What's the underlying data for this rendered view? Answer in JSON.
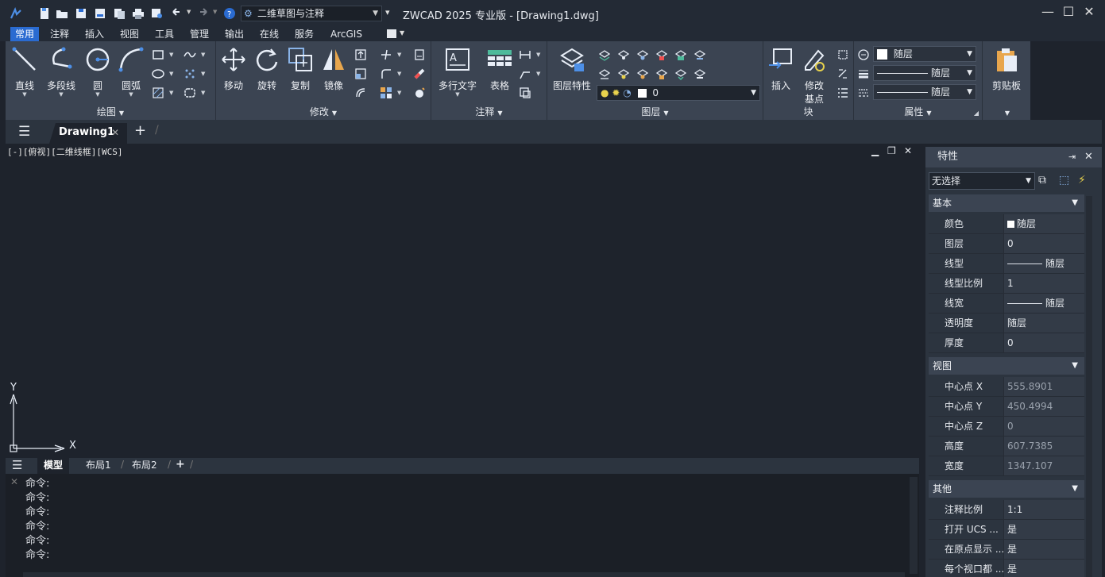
{
  "title_bar": {
    "workspace": "二维草图与注释",
    "app_title": "ZWCAD 2025 专业版 - [Drawing1.dwg]",
    "window_controls": [
      "minimize-icon",
      "maximize-icon",
      "close-icon"
    ]
  },
  "menu_tabs": [
    "常用",
    "注释",
    "插入",
    "视图",
    "工具",
    "管理",
    "输出",
    "在线",
    "服务",
    "ArcGIS"
  ],
  "ribbon": {
    "draw": {
      "label": "绘图",
      "buttons": [
        "直线",
        "多段线",
        "圆",
        "圆弧"
      ]
    },
    "modify": {
      "label": "修改",
      "buttons": [
        "移动",
        "旋转",
        "复制",
        "镜像"
      ]
    },
    "annotation": {
      "label": "注释",
      "buttons": [
        "多行文字",
        "表格"
      ]
    },
    "layer": {
      "label": "图层",
      "button": "图层特性",
      "current_layer": "0"
    },
    "block": {
      "label": "块",
      "buttons": [
        "插入",
        "修改",
        "基点"
      ]
    },
    "properties": {
      "label": "属性",
      "color": "随层",
      "linetype": "随层",
      "lineweight": "随层"
    },
    "clipboard": {
      "label": "剪贴板"
    }
  },
  "doc_tabs": {
    "active": "Drawing1"
  },
  "canvas": {
    "view_label": "[-][俯视][二维线框][WCS]",
    "axis_x": "X",
    "axis_y": "Y"
  },
  "layout_tabs": [
    "模型",
    "布局1",
    "布局2"
  ],
  "command_lines": [
    "命令:",
    "命令:",
    "命令:",
    "命令:",
    "命令:",
    "命令:"
  ],
  "properties_panel": {
    "title": "特性",
    "selection": "无选择",
    "sections": {
      "basic": {
        "label": "基本",
        "rows": [
          {
            "k": "颜色",
            "v": "随层"
          },
          {
            "k": "图层",
            "v": "0"
          },
          {
            "k": "线型",
            "v": "随层"
          },
          {
            "k": "线型比例",
            "v": "1"
          },
          {
            "k": "线宽",
            "v": "随层"
          },
          {
            "k": "透明度",
            "v": "随层"
          },
          {
            "k": "厚度",
            "v": "0"
          }
        ]
      },
      "view": {
        "label": "视图",
        "rows": [
          {
            "k": "中心点 X",
            "v": "555.8901"
          },
          {
            "k": "中心点 Y",
            "v": "450.4994"
          },
          {
            "k": "中心点 Z",
            "v": "0"
          },
          {
            "k": "高度",
            "v": "607.7385"
          },
          {
            "k": "宽度",
            "v": "1347.107"
          }
        ]
      },
      "other": {
        "label": "其他",
        "rows": [
          {
            "k": "注释比例",
            "v": "1:1"
          },
          {
            "k": "打开 UCS ...",
            "v": "是"
          },
          {
            "k": "在原点显示 ...",
            "v": "是"
          },
          {
            "k": "每个视口都 ...",
            "v": "是"
          }
        ]
      }
    }
  },
  "colors": {
    "accent": "#2a6bd1",
    "ribbon_bg": "#3b4452",
    "canvas_bg": "#1e232c"
  }
}
